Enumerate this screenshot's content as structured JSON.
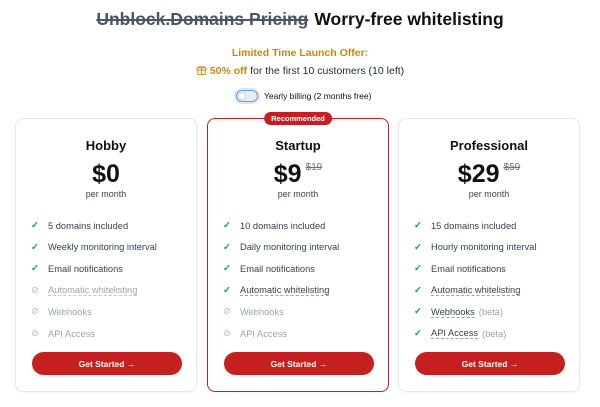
{
  "header": {
    "struck_title": "Unblock.Domains Pricing",
    "title": "Worry-free whitelisting"
  },
  "offer": {
    "title": "Limited Time Launch Offer:",
    "discount": "50% off",
    "detail": "for the first 10 customers (10 left)",
    "icon": "gift-icon"
  },
  "billing": {
    "label": "Yearly billing (2 months free)",
    "enabled": false
  },
  "colors": {
    "accent": "#c51f1f",
    "offer": "#c58a0d",
    "check": "#16a34a"
  },
  "plans": [
    {
      "name": "Hobby",
      "price": "$0",
      "old_price": "",
      "period": "per month",
      "badge": "",
      "cta": "Get Started →",
      "features": [
        {
          "text": "5 domains included",
          "included": true,
          "extra": ""
        },
        {
          "text": "Weekly monitoring interval",
          "included": true,
          "extra": ""
        },
        {
          "text": "Email notifications",
          "included": true,
          "extra": ""
        },
        {
          "text": "Automatic whitelisting",
          "included": false,
          "extra": ""
        },
        {
          "text": "Webhooks",
          "included": false,
          "extra": ""
        },
        {
          "text": "API Access",
          "included": false,
          "extra": ""
        }
      ]
    },
    {
      "name": "Startup",
      "price": "$9",
      "old_price": "$19",
      "period": "per month",
      "badge": "Recommended",
      "cta": "Get Started →",
      "features": [
        {
          "text": "10 domains included",
          "included": true,
          "extra": ""
        },
        {
          "text": "Daily monitoring interval",
          "included": true,
          "extra": ""
        },
        {
          "text": "Email notifications",
          "included": true,
          "extra": ""
        },
        {
          "text": "Automatic whitelisting",
          "included": true,
          "extra": ""
        },
        {
          "text": "Webhooks",
          "included": false,
          "extra": ""
        },
        {
          "text": "API Access",
          "included": false,
          "extra": ""
        }
      ]
    },
    {
      "name": "Professional",
      "price": "$29",
      "old_price": "$59",
      "period": "per month",
      "badge": "",
      "cta": "Get Started →",
      "features": [
        {
          "text": "15 domains included",
          "included": true,
          "extra": ""
        },
        {
          "text": "Hourly monitoring interval",
          "included": true,
          "extra": ""
        },
        {
          "text": "Email notifications",
          "included": true,
          "extra": ""
        },
        {
          "text": "Automatic whitelisting",
          "included": true,
          "extra": ""
        },
        {
          "text": "Webhooks",
          "included": true,
          "extra": "(beta)"
        },
        {
          "text": "API Access",
          "included": true,
          "extra": "(beta)"
        }
      ]
    }
  ]
}
